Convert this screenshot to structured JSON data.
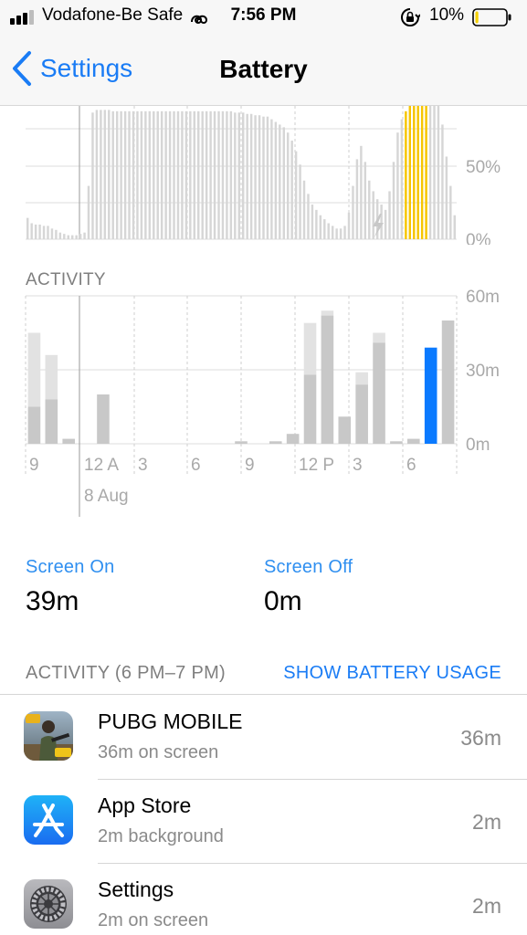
{
  "status_bar": {
    "carrier": "Vodafone-Be Safe",
    "time": "7:56 PM",
    "battery_percent": "10%",
    "battery_level": 0.1,
    "battery_color": "#f5d000",
    "icons": [
      "signal-bars-icon",
      "wifi-calling-icon",
      "orientation-lock-icon",
      "battery-icon"
    ]
  },
  "nav": {
    "back_label": "Settings",
    "title": "Battery",
    "accent_color": "#1a7cf5"
  },
  "battery_chart": {
    "y_tick_labels": [
      "50%",
      "0%"
    ],
    "charging_icon": "charging-bolt-icon",
    "highlight_color": "#f6c500",
    "bar_color": "#d6d6d6"
  },
  "activity_chart": {
    "section_label": "ACTIVITY",
    "y_tick_labels": [
      "60m",
      "30m",
      "0m"
    ],
    "x_tick_labels": [
      "9",
      "12 A",
      "3",
      "6",
      "9",
      "12 P",
      "3",
      "6"
    ],
    "date_label": "8 Aug"
  },
  "chart_data": [
    {
      "type": "bar",
      "title": "",
      "ylabel": "",
      "ylim": [
        0,
        100
      ],
      "y_ticks": [
        "50%",
        "0%"
      ],
      "values": [
        16,
        12,
        11,
        11,
        10,
        10,
        8,
        7,
        5,
        4,
        3,
        3,
        3,
        4,
        5,
        40,
        95,
        97,
        97,
        97,
        97,
        96,
        96,
        96,
        96,
        96,
        96,
        96,
        96,
        96,
        96,
        96,
        96,
        96,
        96,
        96,
        96,
        96,
        96,
        96,
        96,
        96,
        96,
        96,
        96,
        96,
        96,
        96,
        96,
        96,
        96,
        95,
        95,
        95,
        94,
        94,
        93,
        93,
        92,
        92,
        90,
        88,
        86,
        84,
        80,
        74,
        66,
        56,
        44,
        34,
        26,
        22,
        18,
        15,
        12,
        10,
        8,
        8,
        10,
        20,
        40,
        60,
        70,
        58,
        44,
        36,
        30,
        26,
        22,
        36,
        58,
        80,
        90,
        96,
        100,
        100,
        100,
        100,
        100,
        100,
        100,
        100,
        86,
        62,
        40,
        18
      ],
      "charging_segment": [
        93,
        98
      ],
      "grid": true
    },
    {
      "type": "bar",
      "title": "",
      "ylabel": "",
      "ylim": [
        0,
        60
      ],
      "x_ticks": [
        "9",
        "12 A",
        "3",
        "6",
        "9",
        "12 P",
        "3",
        "6"
      ],
      "date_label": "8 Aug",
      "series": [
        {
          "name": "Screen On",
          "values": [
            15,
            18,
            2,
            0,
            20,
            0,
            0,
            0,
            0,
            0,
            0,
            0,
            1,
            0,
            1,
            4,
            28,
            52,
            11,
            24,
            41,
            1,
            2,
            39,
            50
          ]
        },
        {
          "name": "Screen Off",
          "values": [
            30,
            18,
            0,
            0,
            0,
            0,
            0,
            0,
            0,
            0,
            0,
            0,
            0,
            0,
            0,
            0,
            21,
            2,
            0,
            5,
            4,
            0,
            0,
            0,
            0
          ]
        }
      ],
      "highlight_index": 23,
      "grid": true
    }
  ],
  "summary": {
    "screen_on_label": "Screen On",
    "screen_on_value": "39m",
    "screen_off_label": "Screen Off",
    "screen_off_value": "0m"
  },
  "activity_list": {
    "header_left": "ACTIVITY (6 PM–7 PM)",
    "header_right": "SHOW BATTERY USAGE",
    "apps": [
      {
        "name": "PUBG MOBILE",
        "detail": "36m on screen",
        "time": "36m",
        "icon": "pubg-mobile-icon"
      },
      {
        "name": "App Store",
        "detail": "2m background",
        "time": "2m",
        "icon": "app-store-icon"
      },
      {
        "name": "Settings",
        "detail": "2m on screen",
        "time": "2m",
        "icon": "settings-gear-icon"
      }
    ]
  }
}
